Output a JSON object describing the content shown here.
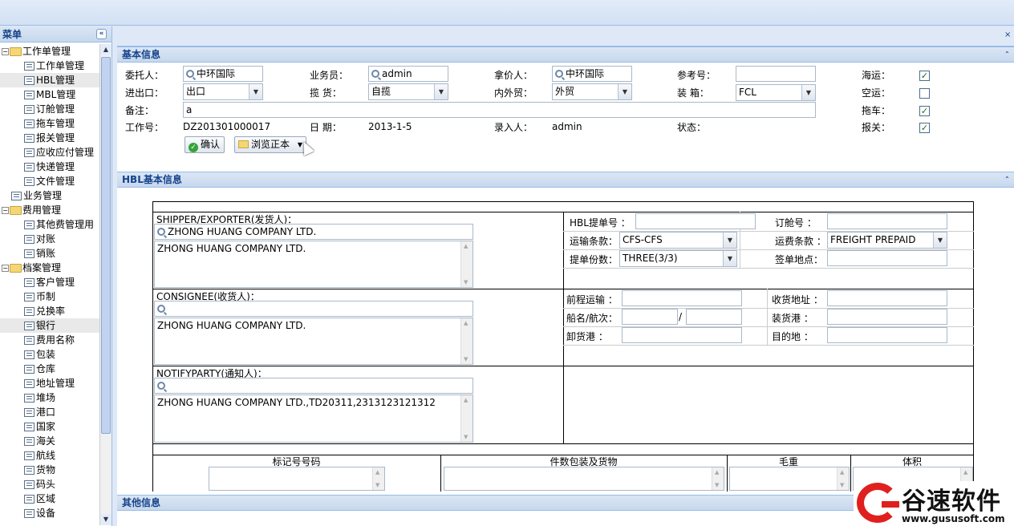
{
  "sidebar": {
    "title": "菜单",
    "collapse_glyph": "«",
    "items": [
      {
        "label": "工作单管理",
        "type": "folder",
        "level": 0,
        "toggle": "−"
      },
      {
        "label": "工作单管理",
        "type": "leaf",
        "level": 1
      },
      {
        "label": "HBL管理",
        "type": "leaf",
        "level": 1,
        "selected": true
      },
      {
        "label": "MBL管理",
        "type": "leaf",
        "level": 1
      },
      {
        "label": "订舱管理",
        "type": "leaf",
        "level": 1
      },
      {
        "label": "拖车管理",
        "type": "leaf",
        "level": 1
      },
      {
        "label": "报关管理",
        "type": "leaf",
        "level": 1
      },
      {
        "label": "应收应付管理",
        "type": "leaf",
        "level": 1
      },
      {
        "label": "快递管理",
        "type": "leaf",
        "level": 1
      },
      {
        "label": "文件管理",
        "type": "leaf",
        "level": 1
      },
      {
        "label": "业务管理",
        "type": "leaf",
        "level": 0
      },
      {
        "label": "费用管理",
        "type": "folder",
        "level": 0,
        "toggle": "−"
      },
      {
        "label": "其他费管理用",
        "type": "leaf",
        "level": 1
      },
      {
        "label": "对账",
        "type": "leaf",
        "level": 1
      },
      {
        "label": "销账",
        "type": "leaf",
        "level": 1
      },
      {
        "label": "档案管理",
        "type": "folder",
        "level": 0,
        "toggle": "−"
      },
      {
        "label": "客户管理",
        "type": "leaf",
        "level": 1
      },
      {
        "label": "币制",
        "type": "leaf",
        "level": 1
      },
      {
        "label": "兑换率",
        "type": "leaf",
        "level": 1
      },
      {
        "label": "银行",
        "type": "leaf",
        "level": 1,
        "hover": true
      },
      {
        "label": "费用名称",
        "type": "leaf",
        "level": 1
      },
      {
        "label": "包装",
        "type": "leaf",
        "level": 1
      },
      {
        "label": "仓库",
        "type": "leaf",
        "level": 1
      },
      {
        "label": "地址管理",
        "type": "leaf",
        "level": 1
      },
      {
        "label": "堆场",
        "type": "leaf",
        "level": 1
      },
      {
        "label": "港口",
        "type": "leaf",
        "level": 1
      },
      {
        "label": "国家",
        "type": "leaf",
        "level": 1
      },
      {
        "label": "海关",
        "type": "leaf",
        "level": 1
      },
      {
        "label": "航线",
        "type": "leaf",
        "level": 1
      },
      {
        "label": "货物",
        "type": "leaf",
        "level": 1
      },
      {
        "label": "码头",
        "type": "leaf",
        "level": 1
      },
      {
        "label": "区域",
        "type": "leaf",
        "level": 1
      },
      {
        "label": "设备",
        "type": "leaf",
        "level": 1
      }
    ]
  },
  "main": {
    "close_glyph": "×",
    "basic": {
      "title": "基本信息",
      "weituoren_label": "委托人：",
      "weituoren": "中环国际",
      "yewuyuan_label": "业务员：",
      "yewuyuan": "admin",
      "najiaren_label": "拿价人：",
      "najiaren": "中环国际",
      "cankao_label": "参考号：",
      "cankao": "",
      "haiyun_label": "海运：",
      "kongyun_label": "空运：",
      "tuoche_label": "拖车：",
      "baoguan_label": "报关：",
      "jinchukou_label": "进出口：",
      "jinchukou": "出口",
      "lanhuo_label": "揽 货：",
      "lanhuo": "自揽",
      "neiwaimao_label": "内外贸：",
      "neiwaimao": "外贸",
      "zhuangxiang_label": "装 箱：",
      "zhuangxiang": "FCL",
      "beizhu_label": "备注：",
      "beizhu": "a",
      "gongzuohao_label": "工作号：",
      "gongzuohao": "DZ201301000017",
      "riqi_label": "日 期：",
      "riqi": "2013-1-5",
      "lururen_label": "录入人：",
      "lururen": "admin",
      "zhuangtai_label": "状态：",
      "confirm_btn": "确认",
      "browse_btn": "浏览正本",
      "check_glyph": "✓"
    },
    "hbl": {
      "title": "HBL基本信息",
      "shipper_label": "SHIPPER/EXPORTER(发货人)：",
      "shipper_search": "ZHONG HUANG COMPANY LTD.",
      "shipper_text": "ZHONG HUANG COMPANY LTD.",
      "consignee_label": "CONSIGNEE(收货人)：",
      "consignee_search": "",
      "consignee_text": "ZHONG HUANG COMPANY LTD.",
      "notify_label": "NOTIFYPARTY(通知人)：",
      "notify_search": "",
      "notify_text": "ZHONG HUANG COMPANY LTD.,TD20311,2313123121312",
      "hbl_no_label": "HBL提单号 ：",
      "hbl_no": "",
      "dingcang_label": "订舱号 ：",
      "dingcang": "",
      "yunshu_label": "运输条款：",
      "yunshu": "CFS-CFS",
      "yunfei_label": "运费条款 ：",
      "yunfei": "FREIGHT PREPAID",
      "tidan_label": "提单份数：",
      "tidan": "THREE(3/3)",
      "qiandan_label": "签单地点：",
      "qiandan": "",
      "qiancheng_label": "前程运输 ：",
      "qiancheng": "",
      "shouhuo_label": "收货地址 ：",
      "shouhuo": "",
      "chuanming_label": "船名/航次：",
      "chuanming": "",
      "hangci": "",
      "slash": "/",
      "zhuanghuo_label": "装货港 ：",
      "zhuanghuo": "",
      "xiehuo_label": "卸货港 ：",
      "xiehuo": "",
      "mudi_label": "目的地 ：",
      "mudi": "",
      "col_marks": "标记号号码",
      "col_goods": "件数包装及货物",
      "col_weight": "毛重",
      "col_volume": "体积"
    },
    "other": {
      "title": "其他信息"
    },
    "toggle_glyph": "⌃"
  },
  "logo": {
    "text": "谷速软件",
    "url": "www.gususoft.com"
  }
}
